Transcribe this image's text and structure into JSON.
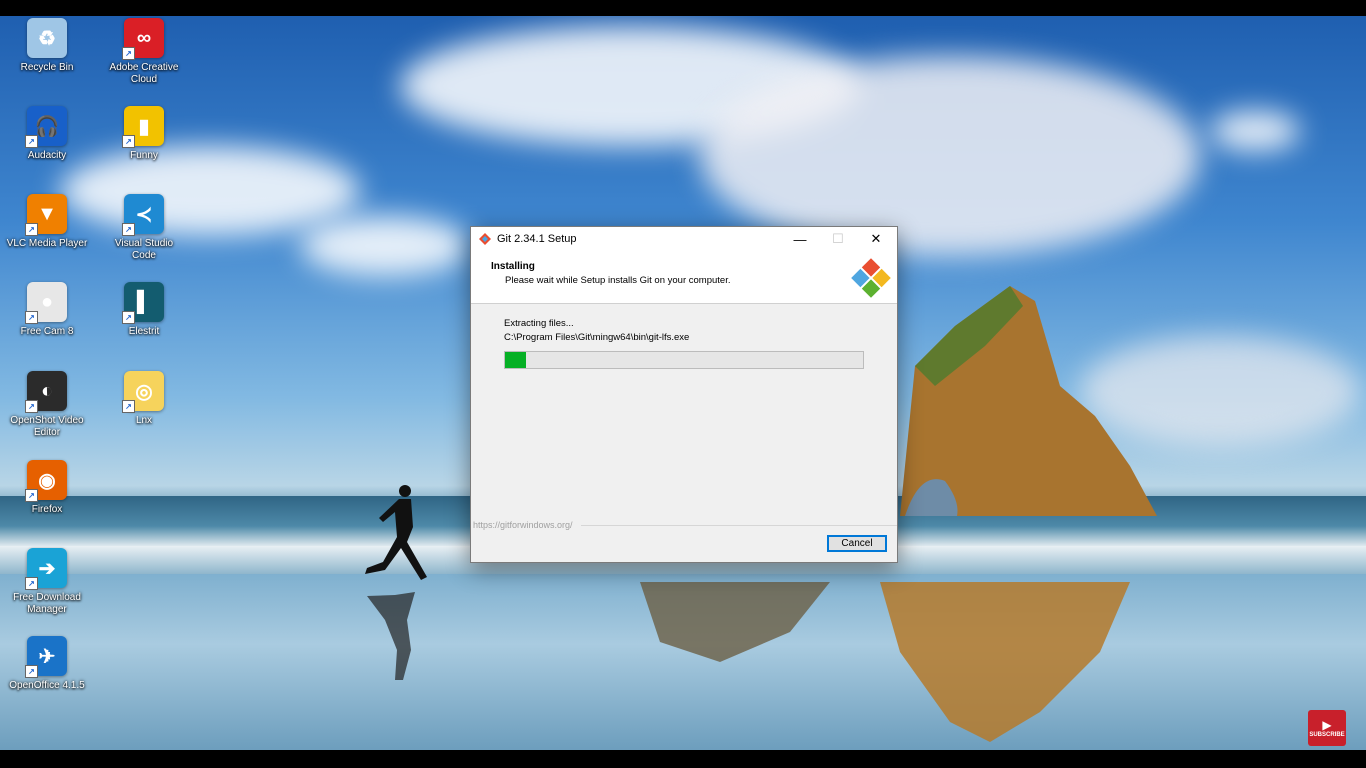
{
  "desktop": {
    "icons": [
      {
        "label": "Recycle Bin",
        "icon": "recycle-bin-icon",
        "color": "#9fc6e6",
        "glyph": "♻"
      },
      {
        "label": "Adobe Creative Cloud",
        "icon": "adobe-cc-icon",
        "color": "#da1f26",
        "glyph": "∞"
      },
      {
        "label": "Audacity",
        "icon": "audacity-icon",
        "color": "#1860c9",
        "glyph": "🎧"
      },
      {
        "label": "Funny",
        "icon": "funny-icon",
        "color": "#f2c200",
        "glyph": "▮"
      },
      {
        "label": "VLC Media Player",
        "icon": "vlc-icon",
        "color": "#f08000",
        "glyph": "▼"
      },
      {
        "label": "Visual Studio Code",
        "icon": "vscode-icon",
        "color": "#1f8ad2",
        "glyph": "≺"
      },
      {
        "label": "Free Cam 8",
        "icon": "freecam-icon",
        "color": "#e7e7e7",
        "glyph": "●"
      },
      {
        "label": "Elestrit",
        "icon": "elestrit-icon",
        "color": "#135c6f",
        "glyph": "▌"
      },
      {
        "label": "OpenShot Video Editor",
        "icon": "openshot-icon",
        "color": "#2b2b2b",
        "glyph": "◐"
      },
      {
        "label": "Lnx",
        "icon": "chrome-icon",
        "color": "#f6d35c",
        "glyph": "◎"
      },
      {
        "label": "Firefox",
        "icon": "firefox-icon",
        "color": "#e66000",
        "glyph": "◉"
      },
      {
        "label": "Free Download Manager",
        "icon": "fdm-icon",
        "color": "#1aa3d6",
        "glyph": "➔"
      },
      {
        "label": "OpenOffice 4.1.5",
        "icon": "openoffice-icon",
        "color": "#1a73c8",
        "glyph": "✈"
      }
    ]
  },
  "dialog": {
    "title": "Git 2.34.1 Setup",
    "minimize_glyph": "—",
    "maximize_glyph": "☐",
    "close_glyph": "✕",
    "header_title": "Installing",
    "header_subtitle": "Please wait while Setup installs Git on your computer.",
    "status": "Extracting files...",
    "current_file": "C:\\Program Files\\Git\\mingw64\\bin\\git-lfs.exe",
    "progress": 0.06,
    "url": "https://gitforwindows.org/",
    "cancel_label": "Cancel"
  },
  "overlay": {
    "subscribe_label": "SUBSCRIBE",
    "play_glyph": "▶"
  },
  "colors": {
    "progress_fill": "#06b025",
    "focus_border": "#0078d7",
    "subscribe_red": "#c8202b"
  }
}
